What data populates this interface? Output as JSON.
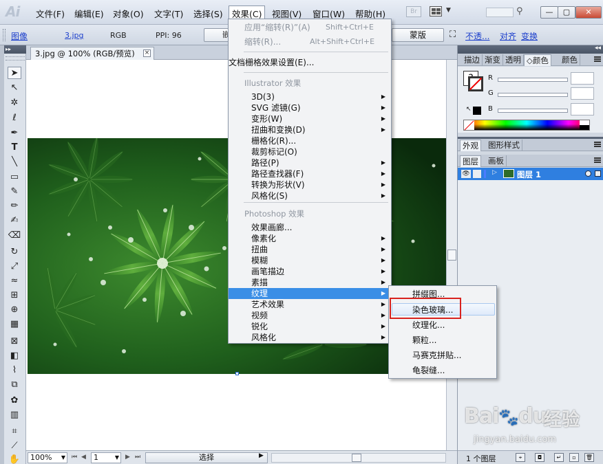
{
  "app": {
    "logo": "Ai"
  },
  "menubar": {
    "items": [
      "文件(F)",
      "编辑(E)",
      "对象(O)",
      "文字(T)",
      "选择(S)",
      "效果(C)",
      "视图(V)",
      "窗口(W)",
      "帮助(H)"
    ],
    "badge": "Br",
    "window_controls": {
      "minimize": "—",
      "restore": "▢",
      "close": "✕"
    }
  },
  "controlbar": {
    "object_type": "图像",
    "file_name": "3.jpg",
    "color_mode": "RGB",
    "ppi": "PPI: 96",
    "embed_button_partial": "嵌",
    "mask_button": "蒙版",
    "opacity_link": "不透...",
    "align_link": "对齐",
    "transform_link": "变换"
  },
  "document": {
    "tab_title": "3.jpg @ 100% (RGB/预览)",
    "close_glyph": "×"
  },
  "statusbar": {
    "zoom": "100%",
    "page": "1",
    "status_label": "选择"
  },
  "effects_menu": {
    "apply_last": "应用“缩转(R)”(A)",
    "apply_last_shortcut": "Shift+Ctrl+E",
    "last_effect": "缩转(R)...",
    "last_effect_shortcut": "Alt+Shift+Ctrl+E",
    "raster_settings": "文档栅格效果设置(E)...",
    "illustrator_header": "Illustrator 效果",
    "illustrator_items": [
      "3D(3)",
      "SVG 滤镜(G)",
      "变形(W)",
      "扭曲和变换(D)",
      "栅格化(R)...",
      "裁剪标记(O)",
      "路径(P)",
      "路径查找器(F)",
      "转换为形状(V)",
      "风格化(S)"
    ],
    "illustrator_has_submenu": [
      true,
      true,
      true,
      true,
      false,
      false,
      true,
      true,
      true,
      true
    ],
    "photoshop_header": "Photoshop 效果",
    "photoshop_items": [
      "效果画廊...",
      "像素化",
      "扭曲",
      "模糊",
      "画笔描边",
      "素描",
      "纹理",
      "艺术效果",
      "视频",
      "锐化",
      "风格化"
    ],
    "photoshop_has_submenu": [
      false,
      true,
      true,
      true,
      true,
      true,
      true,
      true,
      true,
      true,
      true
    ],
    "highlighted": "纹理"
  },
  "texture_submenu": {
    "items": [
      "拼缀图...",
      "染色玻璃...",
      "纹理化...",
      "颗粒...",
      "马赛克拼贴...",
      "龟裂缝..."
    ],
    "hovered": "染色玻璃..."
  },
  "panels": {
    "top_tabs": [
      "描边",
      "渐变",
      "透明",
      "◇颜色",
      "颜色"
    ],
    "color_channels": [
      "R",
      "G",
      "B"
    ],
    "appearance_tabs": [
      "外观",
      "图形样式"
    ],
    "layers_tabs": [
      "图层",
      "画板"
    ],
    "layer_name": "图层 1",
    "layer_count": "1 个图层"
  },
  "watermark": {
    "logo": "Bai",
    "logo_suffix": "du",
    "text": "经验",
    "url": "jingyan.baidu.com"
  },
  "colors": {
    "menu_highlight": "#3a8ee6",
    "layer_selected": "#2f7fe0",
    "callout_red": "#d8221e"
  }
}
